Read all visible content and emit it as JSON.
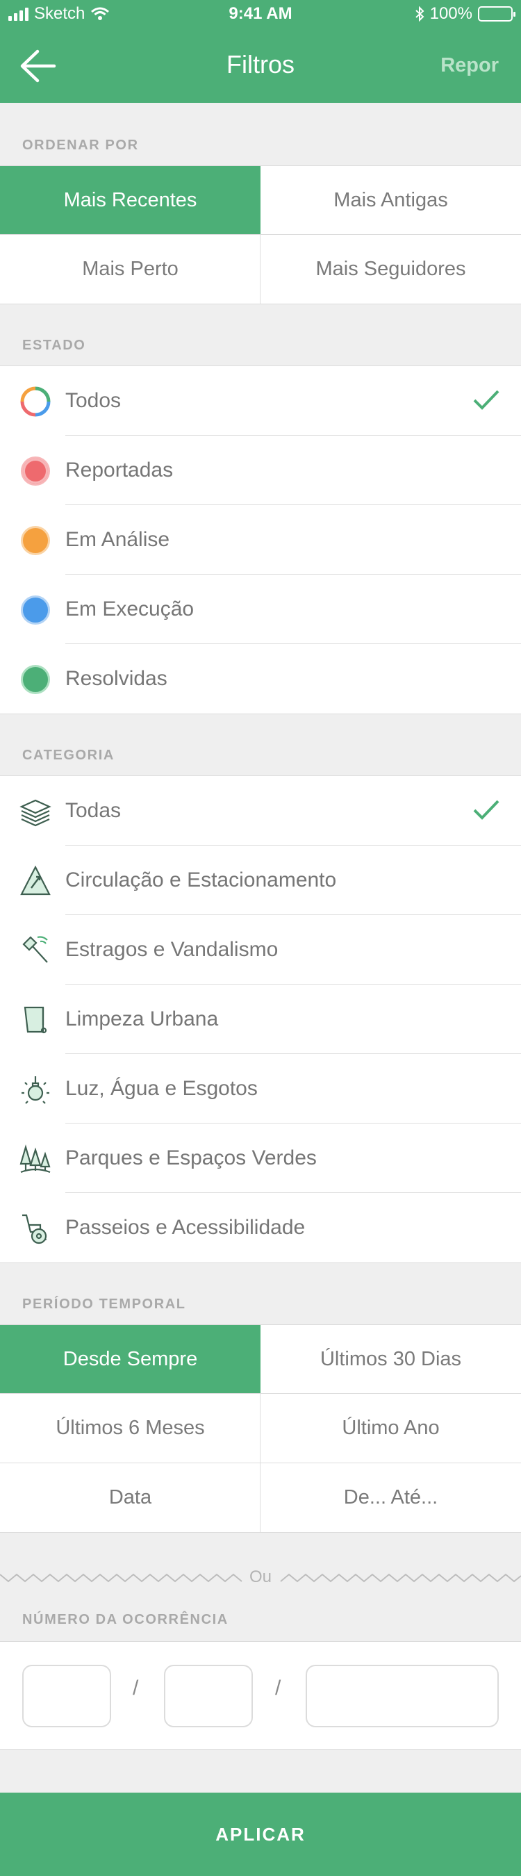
{
  "status_bar": {
    "carrier": "Sketch",
    "time": "9:41 AM",
    "battery": "100%"
  },
  "nav": {
    "title": "Filtros",
    "reset_label": "Repor"
  },
  "sort": {
    "label": "ORDENAR POR",
    "options": [
      "Mais Recentes",
      "Mais Antigas",
      "Mais Perto",
      "Mais Seguidores"
    ],
    "selected": "Mais Recentes"
  },
  "state": {
    "label": "ESTADO",
    "items": [
      {
        "label": "Todos",
        "icon": "ring-multicolor-icon",
        "color": "",
        "selected": true
      },
      {
        "label": "Reportadas",
        "icon": "dot-red-icon",
        "color": "#ee6a6e",
        "selected": false
      },
      {
        "label": "Em Análise",
        "icon": "dot-orange-icon",
        "color": "#f5a13f",
        "selected": false
      },
      {
        "label": "Em Execução",
        "icon": "dot-blue-icon",
        "color": "#4b9bea",
        "selected": false
      },
      {
        "label": "Resolvidas",
        "icon": "dot-green-icon",
        "color": "#4caf77",
        "selected": false
      }
    ]
  },
  "category": {
    "label": "CATEGORIA",
    "items": [
      {
        "label": "Todas",
        "icon": "layers-icon",
        "selected": true
      },
      {
        "label": "Circulação e Estacionamento",
        "icon": "traffic-sign-icon",
        "selected": false
      },
      {
        "label": "Estragos e Vandalismo",
        "icon": "hammer-icon",
        "selected": false
      },
      {
        "label": "Limpeza Urbana",
        "icon": "trash-bin-icon",
        "selected": false
      },
      {
        "label": "Luz, Água e Esgotos",
        "icon": "lightbulb-icon",
        "selected": false
      },
      {
        "label": "Parques e Espaços Verdes",
        "icon": "trees-icon",
        "selected": false
      },
      {
        "label": "Passeios e Acessibilidade",
        "icon": "wheelchair-icon",
        "selected": false
      }
    ]
  },
  "period": {
    "label": "PERÍODO TEMPORAL",
    "options": [
      "Desde Sempre",
      "Últimos 30 Dias",
      "Últimos 6 Meses",
      "Último Ano",
      "Data",
      "De... Até..."
    ],
    "selected": "Desde Sempre"
  },
  "divider_label": "Ou",
  "occurrence": {
    "label": "NÚMERO DA OCORRÊNCIA",
    "separator": "/"
  },
  "apply_label": "APLICAR",
  "colors": {
    "accent": "#4caf77",
    "check": "#4caf77",
    "icon_stroke": "#3e5f50"
  }
}
